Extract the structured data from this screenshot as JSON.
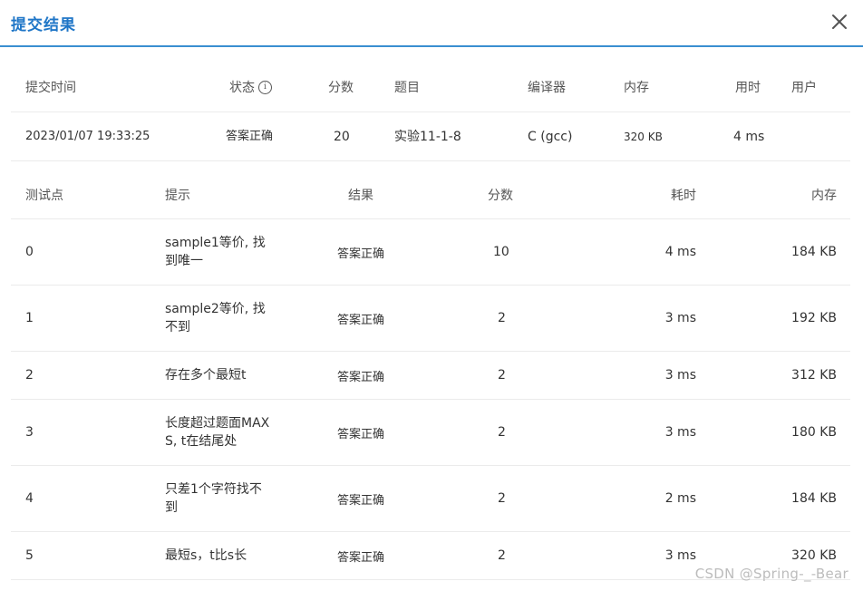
{
  "dialog": {
    "title": "提交结果",
    "close_icon": "close-icon"
  },
  "summary": {
    "headers": {
      "time": "提交时间",
      "status": "状态",
      "score": "分数",
      "problem": "题目",
      "compiler": "编译器",
      "memory": "内存",
      "duration": "用时",
      "user": "用户"
    },
    "info_glyph": "i",
    "row": {
      "time": "2023/01/07 19:33:25",
      "status": "答案正确",
      "score": "20",
      "problem": "实验11-1-8",
      "compiler": "C (gcc)",
      "memory": "320 KB",
      "duration": "4 ms",
      "user": ""
    }
  },
  "cases": {
    "headers": {
      "id": "测试点",
      "hint": "提示",
      "result": "结果",
      "score": "分数",
      "time": "耗时",
      "memory": "内存"
    },
    "rows": [
      {
        "id": "0",
        "hint": "sample1等价, 找到唯一",
        "result": "答案正确",
        "score": "10",
        "time": "4 ms",
        "memory": "184 KB"
      },
      {
        "id": "1",
        "hint": "sample2等价, 找不到",
        "result": "答案正确",
        "score": "2",
        "time": "3 ms",
        "memory": "192 KB"
      },
      {
        "id": "2",
        "hint": "存在多个最短t",
        "result": "答案正确",
        "score": "2",
        "time": "3 ms",
        "memory": "312 KB"
      },
      {
        "id": "3",
        "hint": "长度超过题面MAXS, t在结尾处",
        "result": "答案正确",
        "score": "2",
        "time": "3 ms",
        "memory": "180 KB"
      },
      {
        "id": "4",
        "hint": "只差1个字符找不到",
        "result": "答案正确",
        "score": "2",
        "time": "2 ms",
        "memory": "184 KB"
      },
      {
        "id": "5",
        "hint": "最短s，t比s长",
        "result": "答案正确",
        "score": "2",
        "time": "3 ms",
        "memory": "320 KB"
      }
    ]
  },
  "watermark": "CSDN @Spring-_-Bear",
  "colors": {
    "accent": "#1f76c7",
    "accepted": "#e03131",
    "divider": "#ebebeb"
  }
}
